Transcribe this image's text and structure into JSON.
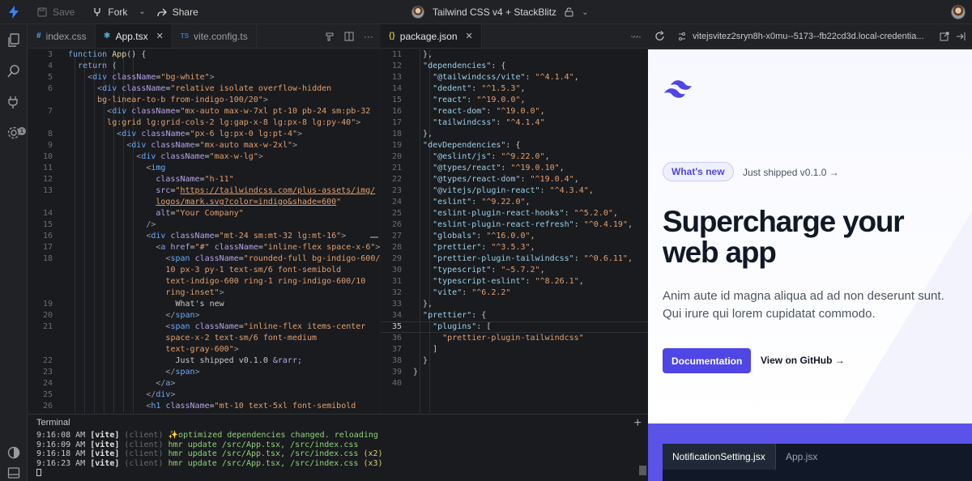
{
  "topbar": {
    "save_label": "Save",
    "fork_label": "Fork",
    "share_label": "Share",
    "project_title": "Tailwind CSS v4 + StackBlitz"
  },
  "activity": {
    "icons": [
      "files-icon",
      "search-icon",
      "plug-icon",
      "gear-icon",
      "theme-icon",
      "panel-icon"
    ],
    "badge": "1"
  },
  "left_editor": {
    "tabs": [
      {
        "label": "index.css",
        "icon": "#"
      },
      {
        "label": "App.tsx",
        "icon": "⚛"
      },
      {
        "label": "vite.config.ts",
        "icon": "TS"
      }
    ],
    "lines": [
      {
        "n": "3",
        "html": "<span class='k'>function</span> <span class='f'>App</span>() {"
      },
      {
        "n": "4",
        "html": "  <span class='k'>return</span> ("
      },
      {
        "n": "5",
        "html": "    <span class='p'>&lt;</span><span class='t'>div</span> <span class='a'>className</span>=<span class='s'>\"bg-white\"</span><span class='p'>&gt;</span>"
      },
      {
        "n": "6",
        "html": "      <span class='p'>&lt;</span><span class='t'>div</span> <span class='a'>className</span>=<span class='s'>\"relative isolate overflow-hidden</span>"
      },
      {
        "n": "",
        "html": "      <span class='s'>bg-linear-to-b from-indigo-100/20\"</span><span class='p'>&gt;</span>"
      },
      {
        "n": "7",
        "html": "        <span class='p'>&lt;</span><span class='t'>div</span> <span class='a'>className</span>=<span class='s'>\"mx-auto max-w-7xl pt-10 pb-24 sm:pb-32</span>"
      },
      {
        "n": "",
        "html": "        <span class='s'>lg:grid lg:grid-cols-2 lg:gap-x-8 lg:px-8 lg:py-40\"</span><span class='p'>&gt;</span>"
      },
      {
        "n": "8",
        "html": "          <span class='p'>&lt;</span><span class='t'>div</span> <span class='a'>className</span>=<span class='s'>\"px-6 lg:px-0 lg:pt-4\"</span><span class='p'>&gt;</span>"
      },
      {
        "n": "9",
        "html": "            <span class='p'>&lt;</span><span class='t'>div</span> <span class='a'>className</span>=<span class='s'>\"mx-auto max-w-2xl\"</span><span class='p'>&gt;</span>"
      },
      {
        "n": "10",
        "html": "              <span class='p'>&lt;</span><span class='t'>div</span> <span class='a'>className</span>=<span class='s'>\"max-w-lg\"</span><span class='p'>&gt;</span>"
      },
      {
        "n": "11",
        "html": "                <span class='p'>&lt;</span><span class='t'>img</span>"
      },
      {
        "n": "12",
        "html": "                  <span class='a'>className</span>=<span class='s'>\"h-11\"</span>"
      },
      {
        "n": "13",
        "html": "                  <span class='a'>src</span>=<span class='s'>\"</span><span class='u'>https://tailwindcss.com/plus-assets/img/</span>"
      },
      {
        "n": "",
        "html": "                  <span class='u'>logos/mark.svg?color=indigo&amp;shade=600</span><span class='s'>\"</span>"
      },
      {
        "n": "14",
        "html": "                  <span class='a'>alt</span>=<span class='s'>\"Your Company\"</span>"
      },
      {
        "n": "15",
        "html": "                <span class='p'>/&gt;</span>"
      },
      {
        "n": "16",
        "html": "                <span class='p'>&lt;</span><span class='t'>div</span> <span class='a'>className</span>=<span class='s'>\"mt-24 sm:mt-32 lg:mt-16\"</span><span class='p'>&gt;</span>"
      },
      {
        "n": "17",
        "html": "                  <span class='p'>&lt;</span><span class='t'>a</span> <span class='a'>href</span>=<span class='s'>\"#\"</span> <span class='a'>className</span>=<span class='s'>\"inline-flex space-x-6\"</span><span class='p'>&gt;</span>"
      },
      {
        "n": "18",
        "html": "                    <span class='p'>&lt;</span><span class='t'>span</span> <span class='a'>className</span>=<span class='s'>\"rounded-full bg-indigo-600/</span>"
      },
      {
        "n": "",
        "html": "                    <span class='s'>10 px-3 py-1 text-sm/6 font-semibold</span>"
      },
      {
        "n": "",
        "html": "                    <span class='s'>text-indigo-600 ring-1 ring-indigo-600/10</span>"
      },
      {
        "n": "",
        "html": "                    <span class='s'>ring-inset\"</span><span class='p'>&gt;</span>"
      },
      {
        "n": "19",
        "html": "                      What's new"
      },
      {
        "n": "20",
        "html": "                    <span class='p'>&lt;/</span><span class='t'>span</span><span class='p'>&gt;</span>"
      },
      {
        "n": "21",
        "html": "                    <span class='p'>&lt;</span><span class='t'>span</span> <span class='a'>className</span>=<span class='s'>\"inline-flex items-center</span>"
      },
      {
        "n": "",
        "html": "                    <span class='s'>space-x-2 text-sm/6 font-medium</span>"
      },
      {
        "n": "",
        "html": "                    <span class='s'>text-gray-600\"</span><span class='p'>&gt;</span>"
      },
      {
        "n": "22",
        "html": "                      Just shipped v0.1.0 <span class='a'>&amp;rarr;</span>"
      },
      {
        "n": "23",
        "html": "                    <span class='p'>&lt;/</span><span class='t'>span</span><span class='p'>&gt;</span>"
      },
      {
        "n": "24",
        "html": "                  <span class='p'>&lt;/</span><span class='t'>a</span><span class='p'>&gt;</span>"
      },
      {
        "n": "25",
        "html": "                <span class='p'>&lt;/</span><span class='t'>div</span><span class='p'>&gt;</span>"
      },
      {
        "n": "26",
        "html": "                <span class='p'>&lt;</span><span class='t'>h1</span> <span class='a'>className</span>=<span class='s'>\"mt-10 text-5xl font-semibold</span>"
      }
    ]
  },
  "right_editor": {
    "tab": {
      "label": "package.json",
      "icon": "{}"
    },
    "current_line": "35",
    "lines": [
      {
        "n": "11",
        "html": "  },"
      },
      {
        "n": "12",
        "html": "  <span class='jk'>\"dependencies\"</span>: {"
      },
      {
        "n": "13",
        "html": "    <span class='jk'>\"@tailwindcss/vite\"</span>: <span class='js'>\"^4.1.4\"</span>,"
      },
      {
        "n": "14",
        "html": "    <span class='jk'>\"dedent\"</span>: <span class='js'>\"^1.5.3\"</span>,"
      },
      {
        "n": "15",
        "html": "    <span class='jk'>\"react\"</span>: <span class='js'>\"^19.0.0\"</span>,"
      },
      {
        "n": "16",
        "html": "    <span class='jk'>\"react-dom\"</span>: <span class='js'>\"^19.0.0\"</span>,"
      },
      {
        "n": "17",
        "html": "    <span class='jk'>\"tailwindcss\"</span>: <span class='js'>\"^4.1.4\"</span>"
      },
      {
        "n": "18",
        "html": "  },"
      },
      {
        "n": "19",
        "html": "  <span class='jk'>\"devDependencies\"</span>: {"
      },
      {
        "n": "20",
        "html": "    <span class='jk'>\"@eslint/js\"</span>: <span class='js'>\"^9.22.0\"</span>,"
      },
      {
        "n": "21",
        "html": "    <span class='jk'>\"@types/react\"</span>: <span class='js'>\"^19.0.10\"</span>,"
      },
      {
        "n": "22",
        "html": "    <span class='jk'>\"@types/react-dom\"</span>: <span class='js'>\"^19.0.4\"</span>,"
      },
      {
        "n": "23",
        "html": "    <span class='jk'>\"@vitejs/plugin-react\"</span>: <span class='js'>\"^4.3.4\"</span>,"
      },
      {
        "n": "24",
        "html": "    <span class='jk'>\"eslint\"</span>: <span class='js'>\"^9.22.0\"</span>,"
      },
      {
        "n": "25",
        "html": "    <span class='jk'>\"eslint-plugin-react-hooks\"</span>: <span class='js'>\"^5.2.0\"</span>,"
      },
      {
        "n": "26",
        "html": "    <span class='jk'>\"eslint-plugin-react-refresh\"</span>: <span class='js'>\"^0.4.19\"</span>,"
      },
      {
        "n": "27",
        "html": "    <span class='jk'>\"globals\"</span>: <span class='js'>\"^16.0.0\"</span>,"
      },
      {
        "n": "28",
        "html": "    <span class='jk'>\"prettier\"</span>: <span class='js'>\"^3.5.3\"</span>,"
      },
      {
        "n": "29",
        "html": "    <span class='jk'>\"prettier-plugin-tailwindcss\"</span>: <span class='js'>\"^0.6.11\"</span>,"
      },
      {
        "n": "30",
        "html": "    <span class='jk'>\"typescript\"</span>: <span class='js'>\"~5.7.2\"</span>,"
      },
      {
        "n": "31",
        "html": "    <span class='jk'>\"typescript-eslint\"</span>: <span class='js'>\"^8.26.1\"</span>,"
      },
      {
        "n": "32",
        "html": "    <span class='jk'>\"vite\"</span>: <span class='js'>\"^6.2.2\"</span>"
      },
      {
        "n": "33",
        "html": "  },"
      },
      {
        "n": "34",
        "html": "  <span class='jk'>\"prettier\"</span>: {"
      },
      {
        "n": "35",
        "html": "    <span class='jk'>\"plugins\"</span>: ["
      },
      {
        "n": "36",
        "html": "      <span class='js'>\"prettier-plugin-tailwindcss\"</span>"
      },
      {
        "n": "37",
        "html": "    ]"
      },
      {
        "n": "38",
        "html": "  }"
      },
      {
        "n": "39",
        "html": "}"
      },
      {
        "n": "40",
        "html": ""
      }
    ]
  },
  "terminal": {
    "title": "Terminal",
    "lines": [
      {
        "time": "9:16:08 AM",
        "tag": "[vite]",
        "src": "(client)",
        "msg": "✨optimized dependencies changed. reloading",
        "count": ""
      },
      {
        "time": "9:16:09 AM",
        "tag": "[vite]",
        "src": "(client)",
        "msg": "hmr update /src/App.tsx, /src/index.css",
        "count": ""
      },
      {
        "time": "9:16:18 AM",
        "tag": "[vite]",
        "src": "(client)",
        "msg": "hmr update /src/App.tsx, /src/index.css",
        "count": "(x2)"
      },
      {
        "time": "9:16:23 AM",
        "tag": "[vite]",
        "src": "(client)",
        "msg": "hmr update /src/App.tsx, /src/index.css",
        "count": "(x3)"
      }
    ]
  },
  "preview": {
    "url": "vitejsvitez2sryn8h-x0mu--5173--fb22cd3d.local-credentia...",
    "pill": "What's new",
    "shipped": "Just shipped v0.1.0 →",
    "headline": "Supercharge your web app",
    "paragraph": "Anim aute id magna aliqua ad ad non deserunt sunt. Qui irure qui lorem cupidatat commodo.",
    "cta_primary": "Documentation",
    "cta_secondary": "View on GitHub →",
    "code_tabs": [
      "NotificationSetting.jsx",
      "App.jsx"
    ],
    "accent": "#4f46e5"
  }
}
